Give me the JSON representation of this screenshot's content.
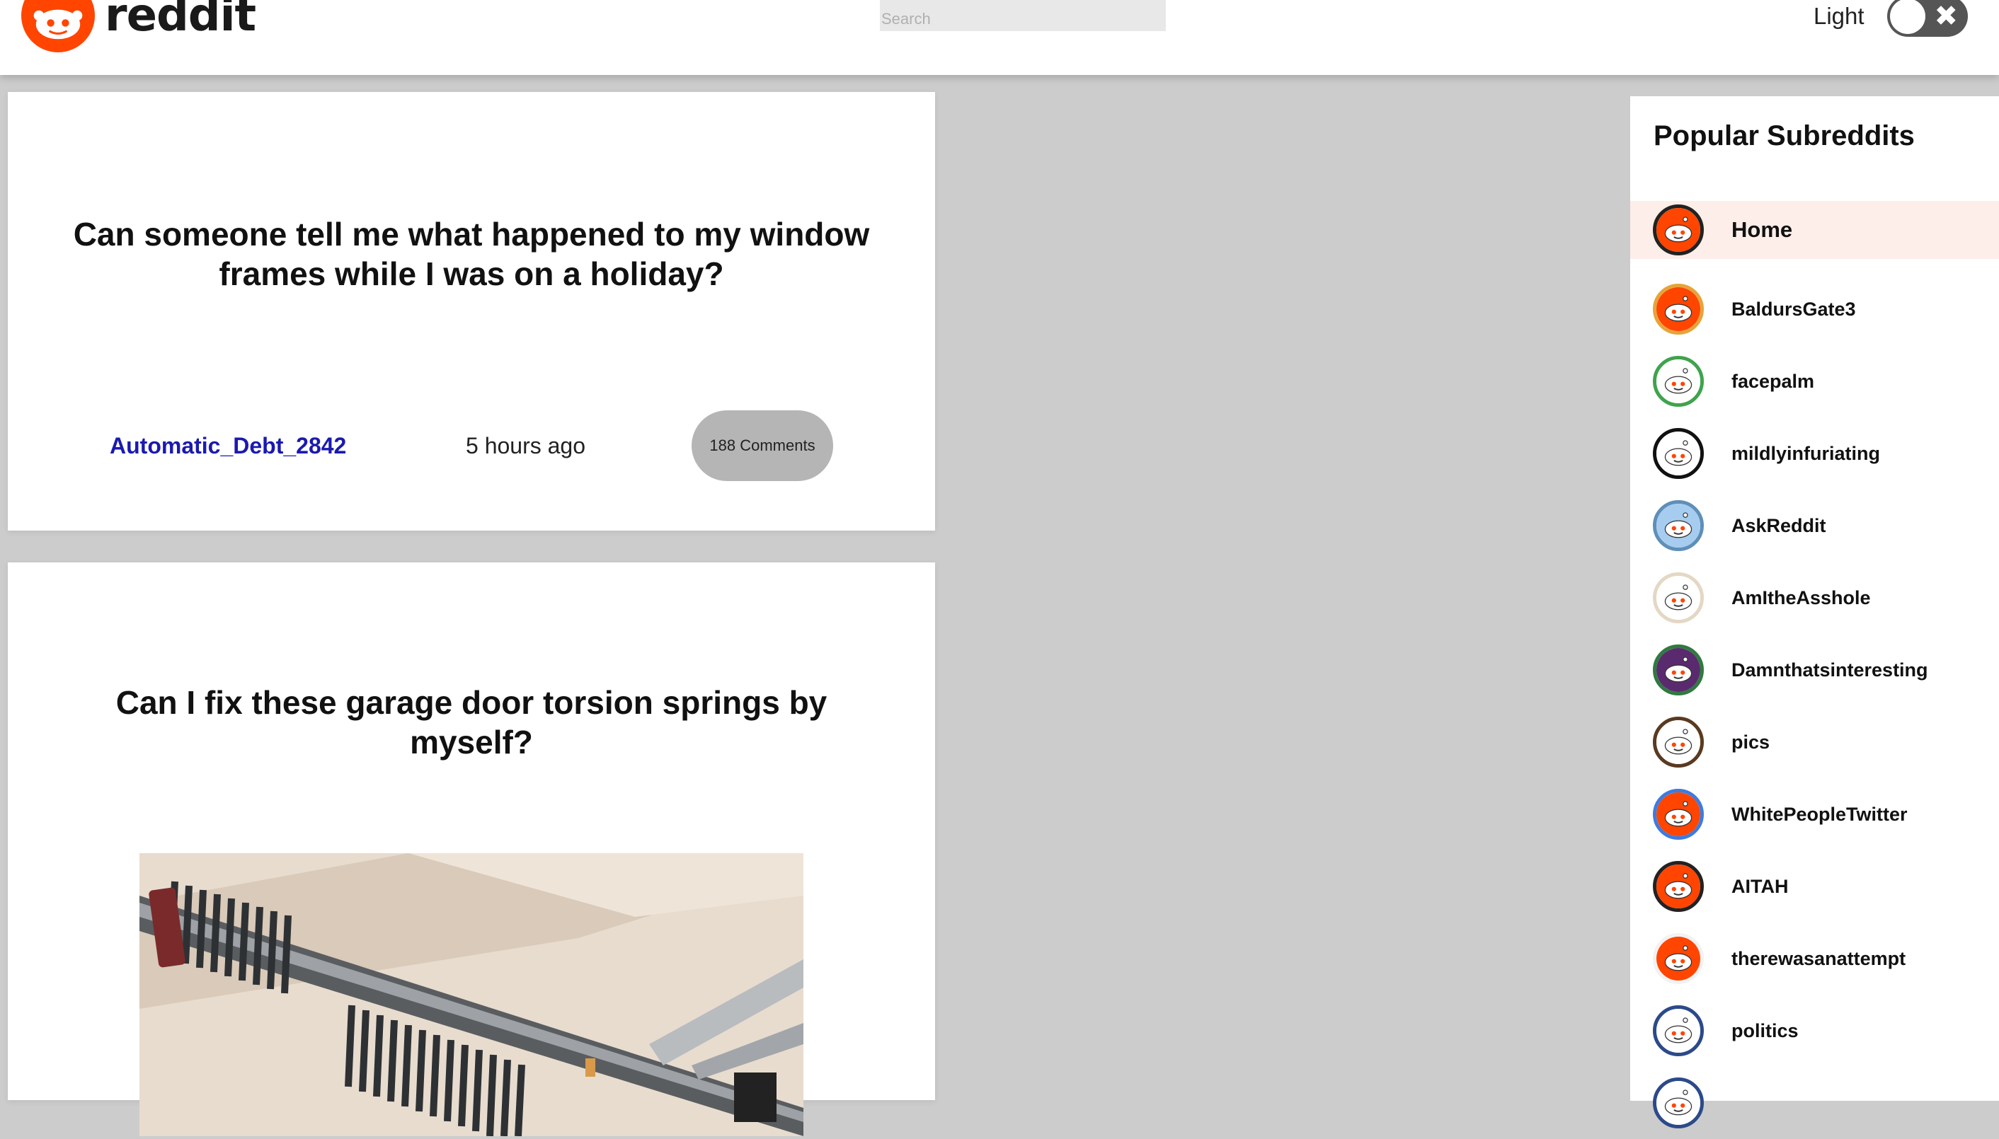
{
  "header": {
    "logo_text": "reddit",
    "search_placeholder": "Search",
    "theme_label": "Light",
    "toggle_glyph": "✖",
    "brand_color": "#ff4500"
  },
  "posts": [
    {
      "title": "Can someone tell me what happened to my window frames while I was on a holiday?",
      "author": "Automatic_Debt_2842",
      "time": "5 hours ago",
      "comments": "188 Comments"
    },
    {
      "title": "Can I fix these garage door torsion springs by myself?",
      "image_alt": "garage door torsion springs photo"
    }
  ],
  "sidebar": {
    "title": "Popular Subreddits",
    "items": [
      {
        "name": "Home",
        "icon": "reddit-snoo-icon",
        "ring": "#222222",
        "fill": "#ff4500"
      },
      {
        "name": "BaldursGate3",
        "icon": "reddit-snoo-icon",
        "ring": "#e6a43a",
        "fill": "#ff4500"
      },
      {
        "name": "facepalm",
        "icon": "facepalm-icon",
        "ring": "#3fa34d",
        "fill": "#ffffff"
      },
      {
        "name": "mildlyinfuriating",
        "icon": "angry-snoo-icon",
        "ring": "#111111",
        "fill": "#ffffff"
      },
      {
        "name": "AskReddit",
        "icon": "question-snoo-icon",
        "ring": "#5f8fb8",
        "fill": "#a6cdf0"
      },
      {
        "name": "AmItheAsshole",
        "icon": "snoo-sketch-icon",
        "ring": "#e4d8c4",
        "fill": "#ffffff"
      },
      {
        "name": "Damnthatsinteresting",
        "icon": "swirl-icon",
        "ring": "#2f7a3f",
        "fill": "#5a2a6e"
      },
      {
        "name": "pics",
        "icon": "camera-snoo-icon",
        "ring": "#5a3a20",
        "fill": "#ffffff"
      },
      {
        "name": "WhitePeopleTwitter",
        "icon": "reddit-snoo-icon",
        "ring": "#3d7be0",
        "fill": "#ff4500"
      },
      {
        "name": "AITAH",
        "icon": "reddit-snoo-icon",
        "ring": "#222222",
        "fill": "#ff4500"
      },
      {
        "name": "therewasanattempt",
        "icon": "reddit-snoo-icon",
        "ring": "#f2f2f2",
        "fill": "#ff4500"
      },
      {
        "name": "politics",
        "icon": "uncle-sam-snoo-icon",
        "ring": "#2c4a8a",
        "fill": "#ffffff"
      },
      {
        "name": "",
        "icon": "question-icon",
        "ring": "#2c4a8a",
        "fill": "#ffffff"
      }
    ]
  }
}
